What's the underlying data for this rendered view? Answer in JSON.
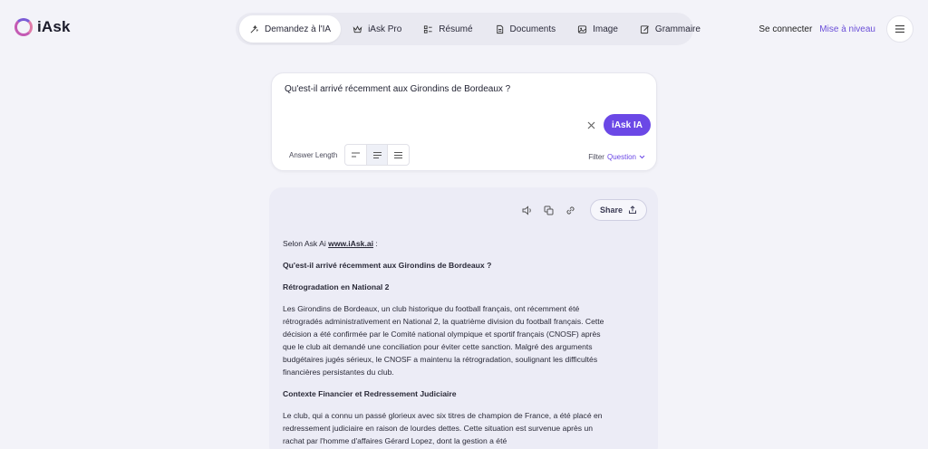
{
  "brand": {
    "name": "iAsk"
  },
  "nav": {
    "tabs": [
      {
        "label": "Demandez à l'IA",
        "icon": "sparkle-icon",
        "active": true
      },
      {
        "label": "iAsk Pro",
        "icon": "crown-icon",
        "active": false
      },
      {
        "label": "Résumé",
        "icon": "summary-icon",
        "active": false
      },
      {
        "label": "Documents",
        "icon": "document-icon",
        "active": false
      },
      {
        "label": "Image",
        "icon": "image-icon",
        "active": false
      },
      {
        "label": "Grammaire",
        "icon": "edit-icon",
        "active": false
      }
    ]
  },
  "header": {
    "login": "Se connecter",
    "upgrade": "Mise à niveau"
  },
  "question": {
    "text": "Qu'est-il arrivé récemment aux Girondins de Bordeaux ?",
    "ask_button": "iAsk IA",
    "answer_length_label": "Answer Length",
    "filter_label": "Filter",
    "filter_value": "Question"
  },
  "answer": {
    "share_label": "Share",
    "intro_prefix": "Selon Ask Ai ",
    "intro_link": "www.iAsk.ai",
    "intro_suffix": " :",
    "heading": "Qu'est-il arrivé récemment aux Girondins de Bordeaux ?",
    "section1_title": "Rétrogradation en National 2",
    "section1_body": "Les Girondins de Bordeaux, un club historique du football français, ont récemment été rétrogradés administrativement en National 2, la quatrième division du football français. Cette décision a été confirmée par le Comité national olympique et sportif français (CNOSF) après que le club ait demandé une conciliation pour éviter cette sanction. Malgré des arguments budgétaires jugés sérieux, le CNOSF a maintenu la rétrogradation, soulignant les difficultés financières persistantes du club.",
    "section2_title": "Contexte Financier et Redressement Judiciaire",
    "section2_body": "Le club, qui a connu un passé glorieux avec six titres de champion de France, a été placé en redressement judiciaire en raison de lourdes dettes. Cette situation est survenue après un rachat par l'homme d'affaires Gérard Lopez, dont la gestion a été"
  },
  "colors": {
    "accent": "#6b48e6",
    "background": "#f3f3f9",
    "answer_bg": "#ececf6"
  }
}
